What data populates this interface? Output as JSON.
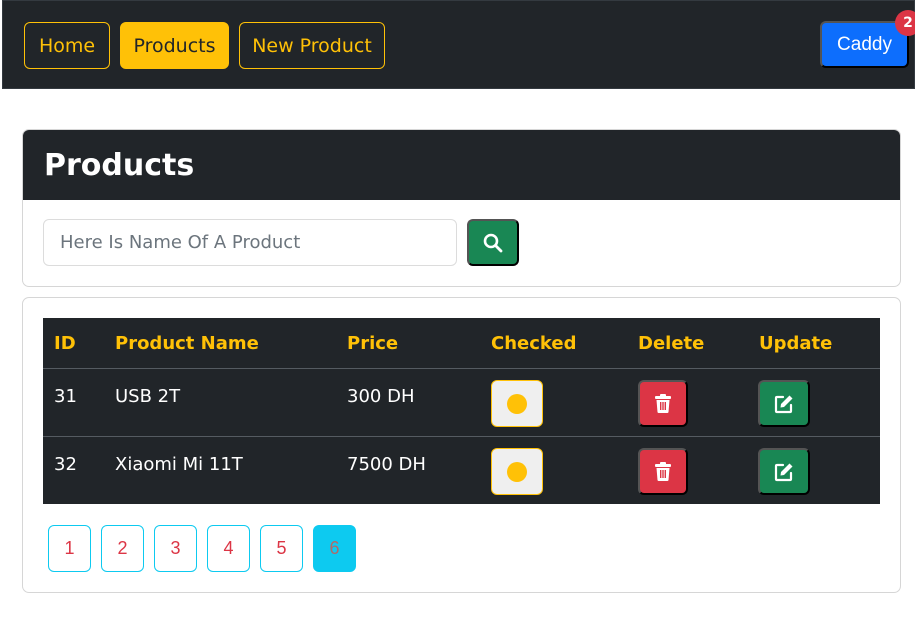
{
  "nav": {
    "home": "Home",
    "products": "Products",
    "new_product": "New Product",
    "caddy": "Caddy",
    "caddy_count": "2"
  },
  "search_card": {
    "title": "Products",
    "placeholder": "Here Is Name Of A Product",
    "search_icon": "search-icon"
  },
  "table": {
    "headers": {
      "id": "ID",
      "name": "Product Name",
      "price": "Price",
      "checked": "Checked",
      "delete": "Delete",
      "update": "Update"
    },
    "rows": [
      {
        "id": "31",
        "name": "USB 2T",
        "price": "300 DH"
      },
      {
        "id": "32",
        "name": "Xiaomi Mi 11T",
        "price": "7500 DH"
      }
    ]
  },
  "pagination": {
    "pages": [
      "1",
      "2",
      "3",
      "4",
      "5",
      "6"
    ],
    "current": "6"
  },
  "colors": {
    "dark": "#212529",
    "warning": "#ffc107",
    "primary": "#0d6efd",
    "danger": "#dc3545",
    "success": "#198754",
    "info": "#0dcaf0"
  }
}
